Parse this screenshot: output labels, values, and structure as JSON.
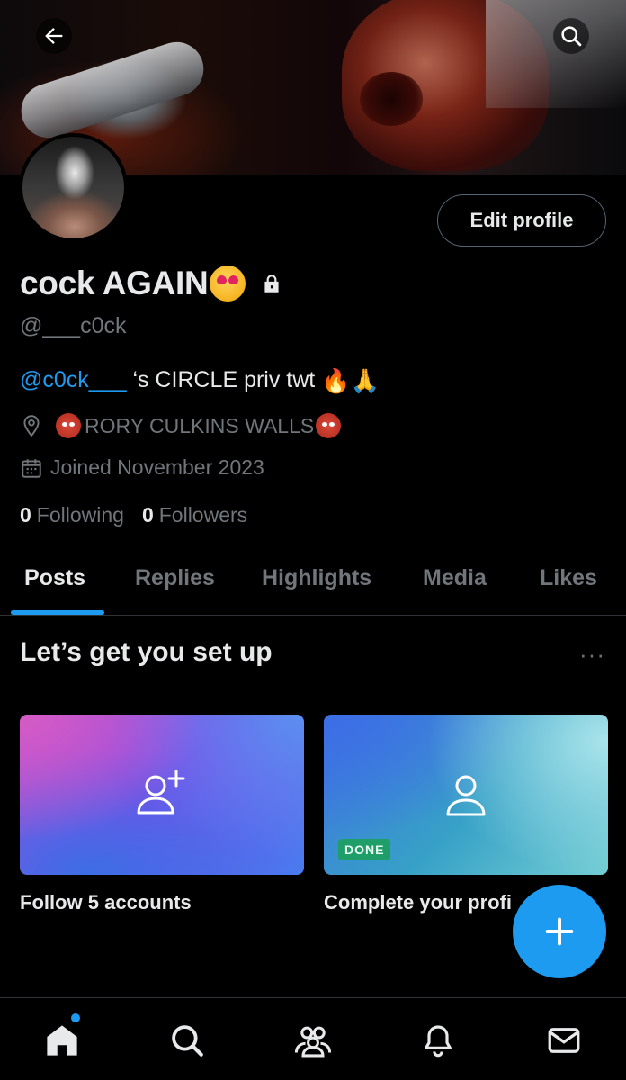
{
  "header": {
    "back_icon": "arrow-left-icon",
    "search_icon": "search-icon"
  },
  "profile": {
    "edit_button": "Edit profile",
    "display_name": "cock AGAIN",
    "handle": "@___c0ck",
    "bio_mention": "@c0ck___",
    "bio_text": " ‘s CIRCLE priv twt ",
    "bio_emoji": "🔥🙏",
    "location": "RORY CULKINS WALLS",
    "joined": "Joined November 2023",
    "following_count": "0",
    "following_label": "Following",
    "followers_count": "0",
    "followers_label": "Followers"
  },
  "tabs": [
    {
      "label": "Posts",
      "active": true
    },
    {
      "label": "Replies",
      "active": false
    },
    {
      "label": "Highlights",
      "active": false
    },
    {
      "label": "Media",
      "active": false
    },
    {
      "label": "Likes",
      "active": false
    }
  ],
  "setup": {
    "title": "Let’s get you set up",
    "more": "···",
    "cards": [
      {
        "label": "Follow 5 accounts",
        "icon": "person-add-icon"
      },
      {
        "label": "Complete your profi",
        "icon": "person-icon",
        "badge": "DONE"
      }
    ]
  },
  "colors": {
    "accent": "#1d9bf0",
    "background": "#000000",
    "text_primary": "#e7e9ea",
    "text_secondary": "#71767b",
    "done_badge": "#1f9e6a"
  },
  "bottom_nav": [
    "home-icon",
    "search-icon",
    "communities-icon",
    "notifications-icon",
    "messages-icon"
  ]
}
